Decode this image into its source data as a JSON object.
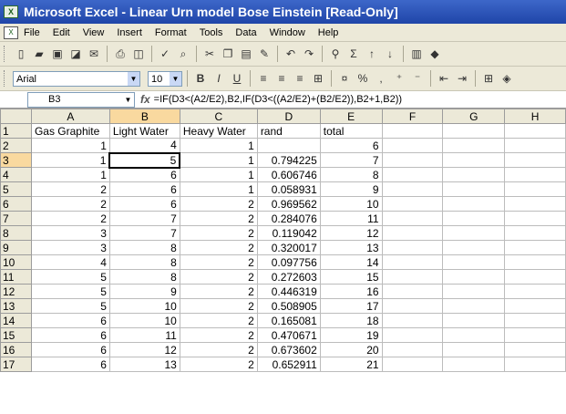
{
  "window": {
    "title": "Microsoft Excel - Linear Urn model Bose Einstein  [Read-Only]"
  },
  "menu": [
    "File",
    "Edit",
    "View",
    "Insert",
    "Format",
    "Tools",
    "Data",
    "Window",
    "Help"
  ],
  "format_bar": {
    "font": "Arial",
    "size": "10",
    "percent": "%"
  },
  "formula_bar": {
    "cell": "B3",
    "fx": "fx",
    "formula": "=IF(D3<(A2/E2),B2,IF(D3<((A2/E2)+(B2/E2)),B2+1,B2))"
  },
  "grid": {
    "columns": [
      "A",
      "B",
      "C",
      "D",
      "E",
      "F",
      "G",
      "H"
    ],
    "rows": [
      {
        "n": "1",
        "a": "Gas Graphite",
        "b": "Light Water",
        "c": "Heavy Water",
        "d": "rand",
        "e": "total"
      },
      {
        "n": "2",
        "a": "1",
        "b": "4",
        "c": "1",
        "d": "",
        "e": "6"
      },
      {
        "n": "3",
        "a": "1",
        "b": "5",
        "c": "1",
        "d": "0.794225",
        "e": "7"
      },
      {
        "n": "4",
        "a": "1",
        "b": "6",
        "c": "1",
        "d": "0.606746",
        "e": "8"
      },
      {
        "n": "5",
        "a": "2",
        "b": "6",
        "c": "1",
        "d": "0.058931",
        "e": "9"
      },
      {
        "n": "6",
        "a": "2",
        "b": "6",
        "c": "2",
        "d": "0.969562",
        "e": "10"
      },
      {
        "n": "7",
        "a": "2",
        "b": "7",
        "c": "2",
        "d": "0.284076",
        "e": "11"
      },
      {
        "n": "8",
        "a": "3",
        "b": "7",
        "c": "2",
        "d": "0.119042",
        "e": "12"
      },
      {
        "n": "9",
        "a": "3",
        "b": "8",
        "c": "2",
        "d": "0.320017",
        "e": "13"
      },
      {
        "n": "10",
        "a": "4",
        "b": "8",
        "c": "2",
        "d": "0.097756",
        "e": "14"
      },
      {
        "n": "11",
        "a": "5",
        "b": "8",
        "c": "2",
        "d": "0.272603",
        "e": "15"
      },
      {
        "n": "12",
        "a": "5",
        "b": "9",
        "c": "2",
        "d": "0.446319",
        "e": "16"
      },
      {
        "n": "13",
        "a": "5",
        "b": "10",
        "c": "2",
        "d": "0.508905",
        "e": "17"
      },
      {
        "n": "14",
        "a": "6",
        "b": "10",
        "c": "2",
        "d": "0.165081",
        "e": "18"
      },
      {
        "n": "15",
        "a": "6",
        "b": "11",
        "c": "2",
        "d": "0.470671",
        "e": "19"
      },
      {
        "n": "16",
        "a": "6",
        "b": "12",
        "c": "2",
        "d": "0.673602",
        "e": "20"
      },
      {
        "n": "17",
        "a": "6",
        "b": "13",
        "c": "2",
        "d": "0.652911",
        "e": "21"
      }
    ]
  }
}
